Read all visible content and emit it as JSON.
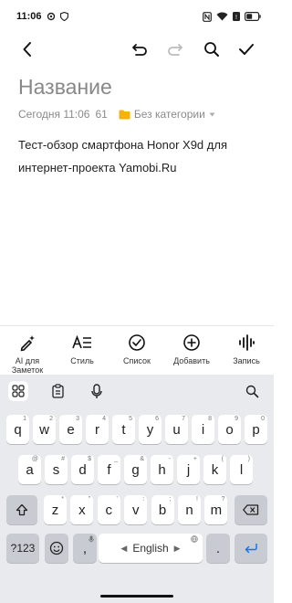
{
  "status": {
    "time": "11:06"
  },
  "note": {
    "title": "Название",
    "date": "Сегодня 11:06",
    "count": "61",
    "category": "Без категории",
    "body": "Тест-обзор смартфона Honor X9d для интернет-проекта Yamobi.Ru"
  },
  "format_bar": [
    {
      "name": "ai",
      "label": "AI для Заметок",
      "icon": "magic-pen-icon"
    },
    {
      "name": "style",
      "label": "Стиль",
      "icon": "text-style-icon"
    },
    {
      "name": "list",
      "label": "Список",
      "icon": "checklist-icon"
    },
    {
      "name": "add",
      "label": "Добавить",
      "icon": "add-circle-icon"
    },
    {
      "name": "record",
      "label": "Запись",
      "icon": "audio-wave-icon"
    }
  ],
  "keyboard": {
    "row1": [
      {
        "k": "q",
        "s": "1"
      },
      {
        "k": "w",
        "s": "2"
      },
      {
        "k": "e",
        "s": "3"
      },
      {
        "k": "r",
        "s": "4"
      },
      {
        "k": "t",
        "s": "5"
      },
      {
        "k": "y",
        "s": "6"
      },
      {
        "k": "u",
        "s": "7"
      },
      {
        "k": "i",
        "s": "8"
      },
      {
        "k": "o",
        "s": "9"
      },
      {
        "k": "p",
        "s": "0"
      }
    ],
    "row2": [
      {
        "k": "a",
        "s": "@"
      },
      {
        "k": "s",
        "s": "#"
      },
      {
        "k": "d",
        "s": "$"
      },
      {
        "k": "f",
        "s": "_"
      },
      {
        "k": "g",
        "s": "&"
      },
      {
        "k": "h",
        "s": "-"
      },
      {
        "k": "j",
        "s": "+"
      },
      {
        "k": "k",
        "s": "("
      },
      {
        "k": "l",
        "s": ")"
      }
    ],
    "row3": [
      {
        "k": "z",
        "s": "*"
      },
      {
        "k": "x",
        "s": "\""
      },
      {
        "k": "c",
        "s": "'"
      },
      {
        "k": "v",
        "s": ":"
      },
      {
        "k": "b",
        "s": ";"
      },
      {
        "k": "n",
        "s": "!"
      },
      {
        "k": "m",
        "s": "?"
      }
    ],
    "symbols_label": "?123",
    "comma": ",",
    "period": ".",
    "space_label": "English"
  },
  "colors": {
    "accent": "#f4b400",
    "key_dark": "#c8ccd2",
    "enter_icon": "#1a73e8"
  }
}
